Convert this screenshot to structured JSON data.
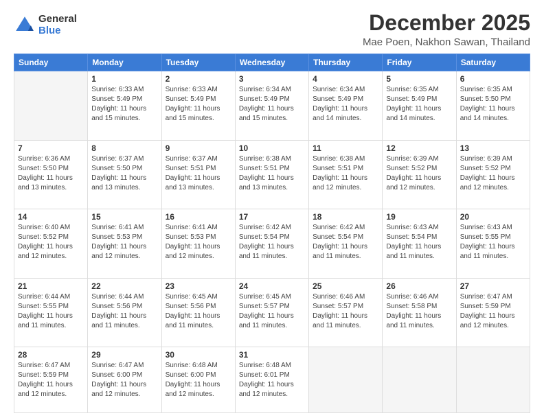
{
  "logo": {
    "general": "General",
    "blue": "Blue"
  },
  "title": "December 2025",
  "subtitle": "Mae Poen, Nakhon Sawan, Thailand",
  "days_header": [
    "Sunday",
    "Monday",
    "Tuesday",
    "Wednesday",
    "Thursday",
    "Friday",
    "Saturday"
  ],
  "weeks": [
    [
      {
        "day": "",
        "empty": true
      },
      {
        "day": "1",
        "sunrise": "6:33 AM",
        "sunset": "5:49 PM",
        "daylight": "11 hours and 15 minutes."
      },
      {
        "day": "2",
        "sunrise": "6:33 AM",
        "sunset": "5:49 PM",
        "daylight": "11 hours and 15 minutes."
      },
      {
        "day": "3",
        "sunrise": "6:34 AM",
        "sunset": "5:49 PM",
        "daylight": "11 hours and 15 minutes."
      },
      {
        "day": "4",
        "sunrise": "6:34 AM",
        "sunset": "5:49 PM",
        "daylight": "11 hours and 14 minutes."
      },
      {
        "day": "5",
        "sunrise": "6:35 AM",
        "sunset": "5:49 PM",
        "daylight": "11 hours and 14 minutes."
      },
      {
        "day": "6",
        "sunrise": "6:35 AM",
        "sunset": "5:50 PM",
        "daylight": "11 hours and 14 minutes."
      }
    ],
    [
      {
        "day": "7",
        "sunrise": "6:36 AM",
        "sunset": "5:50 PM",
        "daylight": "11 hours and 13 minutes."
      },
      {
        "day": "8",
        "sunrise": "6:37 AM",
        "sunset": "5:50 PM",
        "daylight": "11 hours and 13 minutes."
      },
      {
        "day": "9",
        "sunrise": "6:37 AM",
        "sunset": "5:51 PM",
        "daylight": "11 hours and 13 minutes."
      },
      {
        "day": "10",
        "sunrise": "6:38 AM",
        "sunset": "5:51 PM",
        "daylight": "11 hours and 13 minutes."
      },
      {
        "day": "11",
        "sunrise": "6:38 AM",
        "sunset": "5:51 PM",
        "daylight": "11 hours and 12 minutes."
      },
      {
        "day": "12",
        "sunrise": "6:39 AM",
        "sunset": "5:52 PM",
        "daylight": "11 hours and 12 minutes."
      },
      {
        "day": "13",
        "sunrise": "6:39 AM",
        "sunset": "5:52 PM",
        "daylight": "11 hours and 12 minutes."
      }
    ],
    [
      {
        "day": "14",
        "sunrise": "6:40 AM",
        "sunset": "5:52 PM",
        "daylight": "11 hours and 12 minutes."
      },
      {
        "day": "15",
        "sunrise": "6:41 AM",
        "sunset": "5:53 PM",
        "daylight": "11 hours and 12 minutes."
      },
      {
        "day": "16",
        "sunrise": "6:41 AM",
        "sunset": "5:53 PM",
        "daylight": "11 hours and 12 minutes."
      },
      {
        "day": "17",
        "sunrise": "6:42 AM",
        "sunset": "5:54 PM",
        "daylight": "11 hours and 11 minutes."
      },
      {
        "day": "18",
        "sunrise": "6:42 AM",
        "sunset": "5:54 PM",
        "daylight": "11 hours and 11 minutes."
      },
      {
        "day": "19",
        "sunrise": "6:43 AM",
        "sunset": "5:54 PM",
        "daylight": "11 hours and 11 minutes."
      },
      {
        "day": "20",
        "sunrise": "6:43 AM",
        "sunset": "5:55 PM",
        "daylight": "11 hours and 11 minutes."
      }
    ],
    [
      {
        "day": "21",
        "sunrise": "6:44 AM",
        "sunset": "5:55 PM",
        "daylight": "11 hours and 11 minutes."
      },
      {
        "day": "22",
        "sunrise": "6:44 AM",
        "sunset": "5:56 PM",
        "daylight": "11 hours and 11 minutes."
      },
      {
        "day": "23",
        "sunrise": "6:45 AM",
        "sunset": "5:56 PM",
        "daylight": "11 hours and 11 minutes."
      },
      {
        "day": "24",
        "sunrise": "6:45 AM",
        "sunset": "5:57 PM",
        "daylight": "11 hours and 11 minutes."
      },
      {
        "day": "25",
        "sunrise": "6:46 AM",
        "sunset": "5:57 PM",
        "daylight": "11 hours and 11 minutes."
      },
      {
        "day": "26",
        "sunrise": "6:46 AM",
        "sunset": "5:58 PM",
        "daylight": "11 hours and 11 minutes."
      },
      {
        "day": "27",
        "sunrise": "6:47 AM",
        "sunset": "5:59 PM",
        "daylight": "11 hours and 12 minutes."
      }
    ],
    [
      {
        "day": "28",
        "sunrise": "6:47 AM",
        "sunset": "5:59 PM",
        "daylight": "11 hours and 12 minutes."
      },
      {
        "day": "29",
        "sunrise": "6:47 AM",
        "sunset": "6:00 PM",
        "daylight": "11 hours and 12 minutes."
      },
      {
        "day": "30",
        "sunrise": "6:48 AM",
        "sunset": "6:00 PM",
        "daylight": "11 hours and 12 minutes."
      },
      {
        "day": "31",
        "sunrise": "6:48 AM",
        "sunset": "6:01 PM",
        "daylight": "11 hours and 12 minutes."
      },
      {
        "day": "",
        "empty": true
      },
      {
        "day": "",
        "empty": true
      },
      {
        "day": "",
        "empty": true
      }
    ]
  ]
}
